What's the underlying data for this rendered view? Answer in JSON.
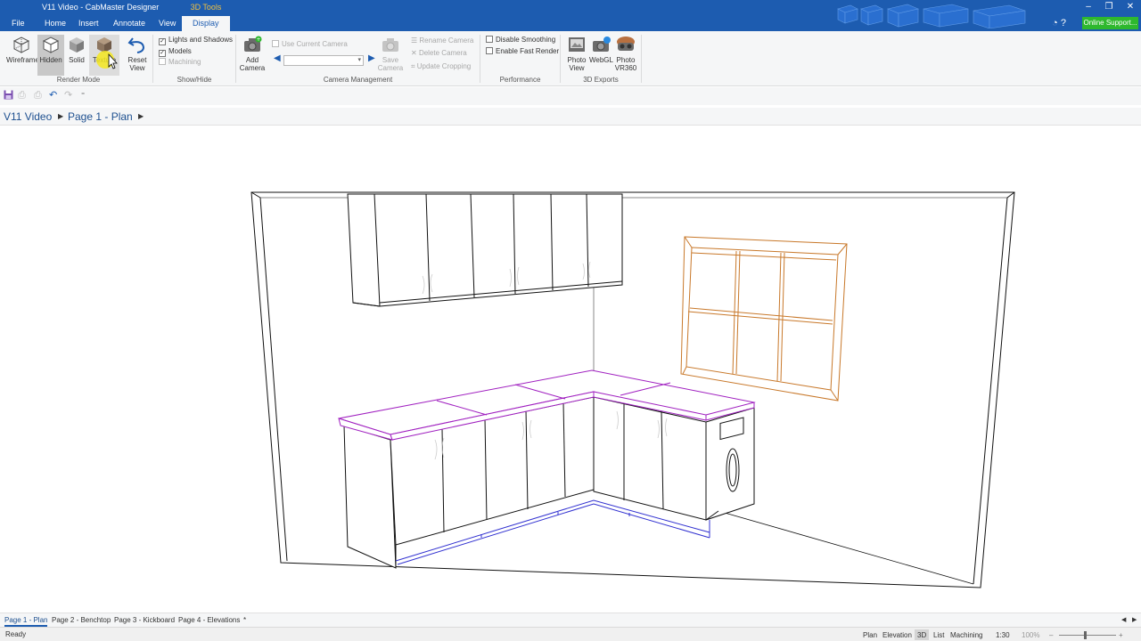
{
  "window": {
    "title": "V11 Video - CabMaster Designer",
    "context_tab": "3D Tools",
    "controls": [
      "–",
      "❐",
      "✕"
    ]
  },
  "menu": {
    "items": [
      "File",
      "Home",
      "Insert",
      "Annotate",
      "View",
      "Display"
    ],
    "active": "Display",
    "online_support": "Online Support...",
    "help_glyphs": "◔ ?"
  },
  "ribbon": {
    "render_mode": {
      "label": "Render Mode",
      "buttons": [
        "Wireframe",
        "Hidden",
        "Solid",
        "Texture",
        "Reset\nView"
      ],
      "selected": "Hidden"
    },
    "show_hide": {
      "label": "Show/Hide",
      "options": [
        {
          "text": "Lights and Shadows",
          "checked": true,
          "enabled": true
        },
        {
          "text": "Models",
          "checked": true,
          "enabled": true
        },
        {
          "text": "Machining",
          "checked": false,
          "enabled": false
        }
      ]
    },
    "camera": {
      "label": "Camera Management",
      "add_camera": "Add\nCamera",
      "use_current": "Use Current Camera",
      "save_camera": "Save\nCamera",
      "rename": "Rename Camera",
      "delete": "Delete Camera",
      "update_cropping": "Update Cropping",
      "select_value": ""
    },
    "performance": {
      "label": "Performance",
      "options": [
        {
          "text": "Disable Smoothing",
          "checked": false
        },
        {
          "text": "Enable Fast Render",
          "checked": false
        }
      ]
    },
    "exports": {
      "label": "3D Exports",
      "buttons": [
        "Photo\nView",
        "WebGL",
        "Photo\nVR360"
      ]
    }
  },
  "breadcrumb": [
    "V11 Video",
    "Page 1 - Plan"
  ],
  "page_tabs": [
    "Page 1 - Plan",
    "Page 2 - Benchtop",
    "Page 3 - Kickboard",
    "Page 4 - Elevations",
    "*"
  ],
  "active_page": "Page 1 - Plan",
  "status": {
    "text": "Ready",
    "views": [
      "Plan",
      "Elevation",
      "3D",
      "List",
      "Machining"
    ],
    "active_view": "3D",
    "scale": "1:30",
    "zoom": "100%",
    "zoom_minus": "–",
    "zoom_plus": "+"
  },
  "colors": {
    "accent": "#1d5cb0",
    "window_frame": "#c8782a",
    "benchtop": "#a020c0",
    "kickboard": "#3030d0",
    "online_support": "#2eb82e"
  }
}
